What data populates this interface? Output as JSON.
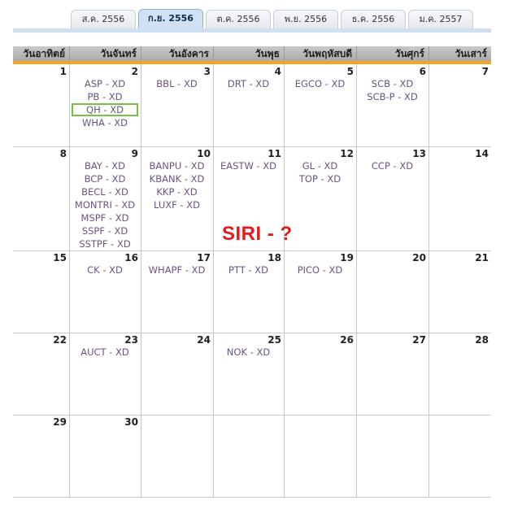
{
  "month_tabs": [
    {
      "label": "ส.ค. 2556",
      "active": false
    },
    {
      "label": "ก.ย. 2556",
      "active": true
    },
    {
      "label": "ต.ค. 2556",
      "active": false
    },
    {
      "label": "พ.ย. 2556",
      "active": false
    },
    {
      "label": "ธ.ค. 2556",
      "active": false
    },
    {
      "label": "ม.ค. 2557",
      "active": false
    }
  ],
  "weekday_headers": [
    "วันอาทิตย์",
    "วันจันทร์",
    "วันอังคาร",
    "วันพุธ",
    "วันพฤหัสบดี",
    "วันศุกร์",
    "วันเสาร์"
  ],
  "weeks": [
    [
      {
        "day": "1",
        "events": []
      },
      {
        "day": "2",
        "events": [
          "ASP - XD",
          "PB - XD",
          "QH - XD",
          "WHA - XD"
        ]
      },
      {
        "day": "3",
        "events": [
          "BBL - XD"
        ]
      },
      {
        "day": "4",
        "events": [
          "DRT - XD"
        ]
      },
      {
        "day": "5",
        "events": [
          "EGCO - XD"
        ]
      },
      {
        "day": "6",
        "events": [
          "SCB - XD",
          "SCB-P - XD"
        ]
      },
      {
        "day": "7",
        "events": []
      }
    ],
    [
      {
        "day": "8",
        "events": []
      },
      {
        "day": "9",
        "events": [
          "BAY - XD",
          "BCP - XD",
          "BECL - XD",
          "MONTRI - XD",
          "MSPF - XD",
          "SSPF - XD",
          "SSTPF - XD"
        ]
      },
      {
        "day": "10",
        "events": [
          "BANPU - XD",
          "KBANK - XD",
          "KKP - XD",
          "LUXF - XD"
        ]
      },
      {
        "day": "11",
        "events": [
          "EASTW - XD"
        ]
      },
      {
        "day": "12",
        "events": [
          "GL - XD",
          "TOP - XD"
        ]
      },
      {
        "day": "13",
        "events": [
          "CCP - XD"
        ]
      },
      {
        "day": "14",
        "events": []
      }
    ],
    [
      {
        "day": "15",
        "events": []
      },
      {
        "day": "16",
        "events": [
          "CK - XD"
        ]
      },
      {
        "day": "17",
        "events": [
          "WHAPF - XD"
        ]
      },
      {
        "day": "18",
        "events": [
          "PTT - XD"
        ]
      },
      {
        "day": "19",
        "events": [
          "PICO - XD"
        ]
      },
      {
        "day": "20",
        "events": []
      },
      {
        "day": "21",
        "events": []
      }
    ],
    [
      {
        "day": "22",
        "events": []
      },
      {
        "day": "23",
        "events": [
          "AUCT - XD"
        ]
      },
      {
        "day": "24",
        "events": []
      },
      {
        "day": "25",
        "events": [
          "NOK - XD"
        ]
      },
      {
        "day": "26",
        "events": []
      },
      {
        "day": "27",
        "events": []
      },
      {
        "day": "28",
        "events": []
      }
    ],
    [
      {
        "day": "29",
        "events": []
      },
      {
        "day": "30",
        "events": []
      },
      {
        "day": "",
        "events": []
      },
      {
        "day": "",
        "events": []
      },
      {
        "day": "",
        "events": []
      },
      {
        "day": "",
        "events": []
      },
      {
        "day": "",
        "events": []
      }
    ]
  ],
  "highlighted_event": "QH - XD",
  "annotation": "SIRI - ?",
  "colors": {
    "event_text": "#6a5580",
    "highlight_border": "#7ac143",
    "annotation": "#e41b1b",
    "header_accent": "#f4a521",
    "active_tab": "#cfe1f3"
  }
}
